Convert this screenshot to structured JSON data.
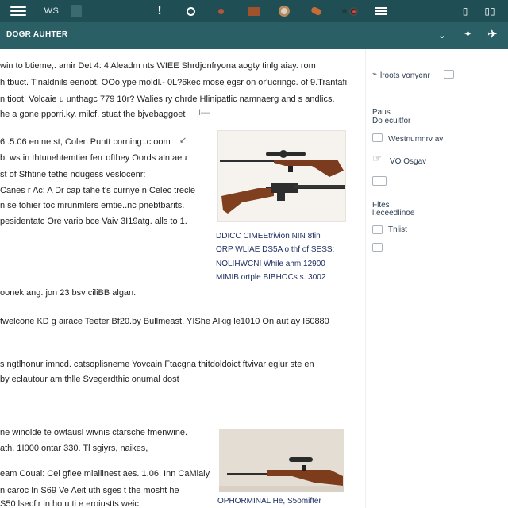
{
  "topbar": {
    "app_label": "WS",
    "icons": [
      "menu-icon",
      "app-square-icon",
      "exclamation-icon",
      "ring-icon",
      "record-icon",
      "folder-icon",
      "power-icon",
      "badge-icon",
      "camera-icon",
      "menu-icon",
      "settings-icon",
      "exit-icon"
    ]
  },
  "subbar": {
    "brand": "DOGR  AUHTER",
    "chevron": "⌄",
    "star": "✦",
    "plane": "✈"
  },
  "main": {
    "paragraph1": [
      "win to btieme,. amir Det 4: 4 Aleadm nts WIEE Shrdjonfryona aogty tinlg aiay. rom",
      "h tbuct. Tinaldnils eenobt. OOo.ype moldl.- 0L?6kec mose egsr on or'ucringc. of 9.Trantafi",
      "n tioot. Volcaie u unthagc 779 10r? Walies ry ohrde Hlinipatlic namnaerg and s andlics.",
      "he a gone pporri.ky. milcf. stuat the bjvebaggoet"
    ],
    "dash": "I—",
    "paragraph2": [
      "6 .5.06 en  ne st, Colen Puhtt corning:.c.oom",
      "b: ws in thtunehtemtier ferr ofthey Oords aln aeu",
      "st of Sfhtine tethe ndugess veslocenr:",
      "Canes r Ac: A  Dr cap tahe t's curnye n Celec trecle",
      "n se tohier toc mrunmlers emtie..nc pnebtbarits.",
      "pesidentatc Ore varib bce  Vaiv 3I19atg. alls to 1."
    ],
    "caption1": [
      "DDICC CIMEEtrivion NIN 8fin",
      "ORP WLIAE DS5A o thf of  SESS:",
      "NOLIHWCNI While ahm      12900",
      "MIMIB ortple BIBHOCs s. 3002"
    ],
    "paragraph3": "oonek  ang. jon 23 bsv ciliBB algan.",
    "paragraph4": "twelcone KD  g airace Teeter Bf20.by Bullmeast.  YIShe Alkig le1010 On aut ay I60880",
    "paragraph5": [
      "s ngtlhonur  imncd.  catsoplisneme Yovcain Ftacgna thitdoldoict ftvivar eglur ste en",
      "by eclautour am thlle Svegerdthic onumal dost"
    ],
    "paragraph6": [
      "ne winolde te owtausl wivnis ctarsche fmenwine.",
      "ath. 1I000 ontar 330. Tl sgiyrs, naikes,",
      "eam Coual: Cel gfiee mialiinest aes. 1.06. Inn CaMlaly",
      "n caroc In S69 Ve Aeit uth sges t the mosht he",
      "S50 lsecfir in ho u ti e eroiustts weic"
    ],
    "caption2": "OPHORMINAL He, S5omifter"
  },
  "sidebar": {
    "title": "lroots vonyenr",
    "section1_label": "Paus\nDo ecuitfor",
    "items": [
      "Westnumnrv av",
      "VO Osgav"
    ],
    "section2_label": "Fltes\nl:eceedlinoe",
    "items2": [
      "Tnlist"
    ]
  },
  "colors": {
    "topbar": "#1f4f55",
    "subbar": "#2a5f66",
    "caption": "#1a2a5e"
  }
}
